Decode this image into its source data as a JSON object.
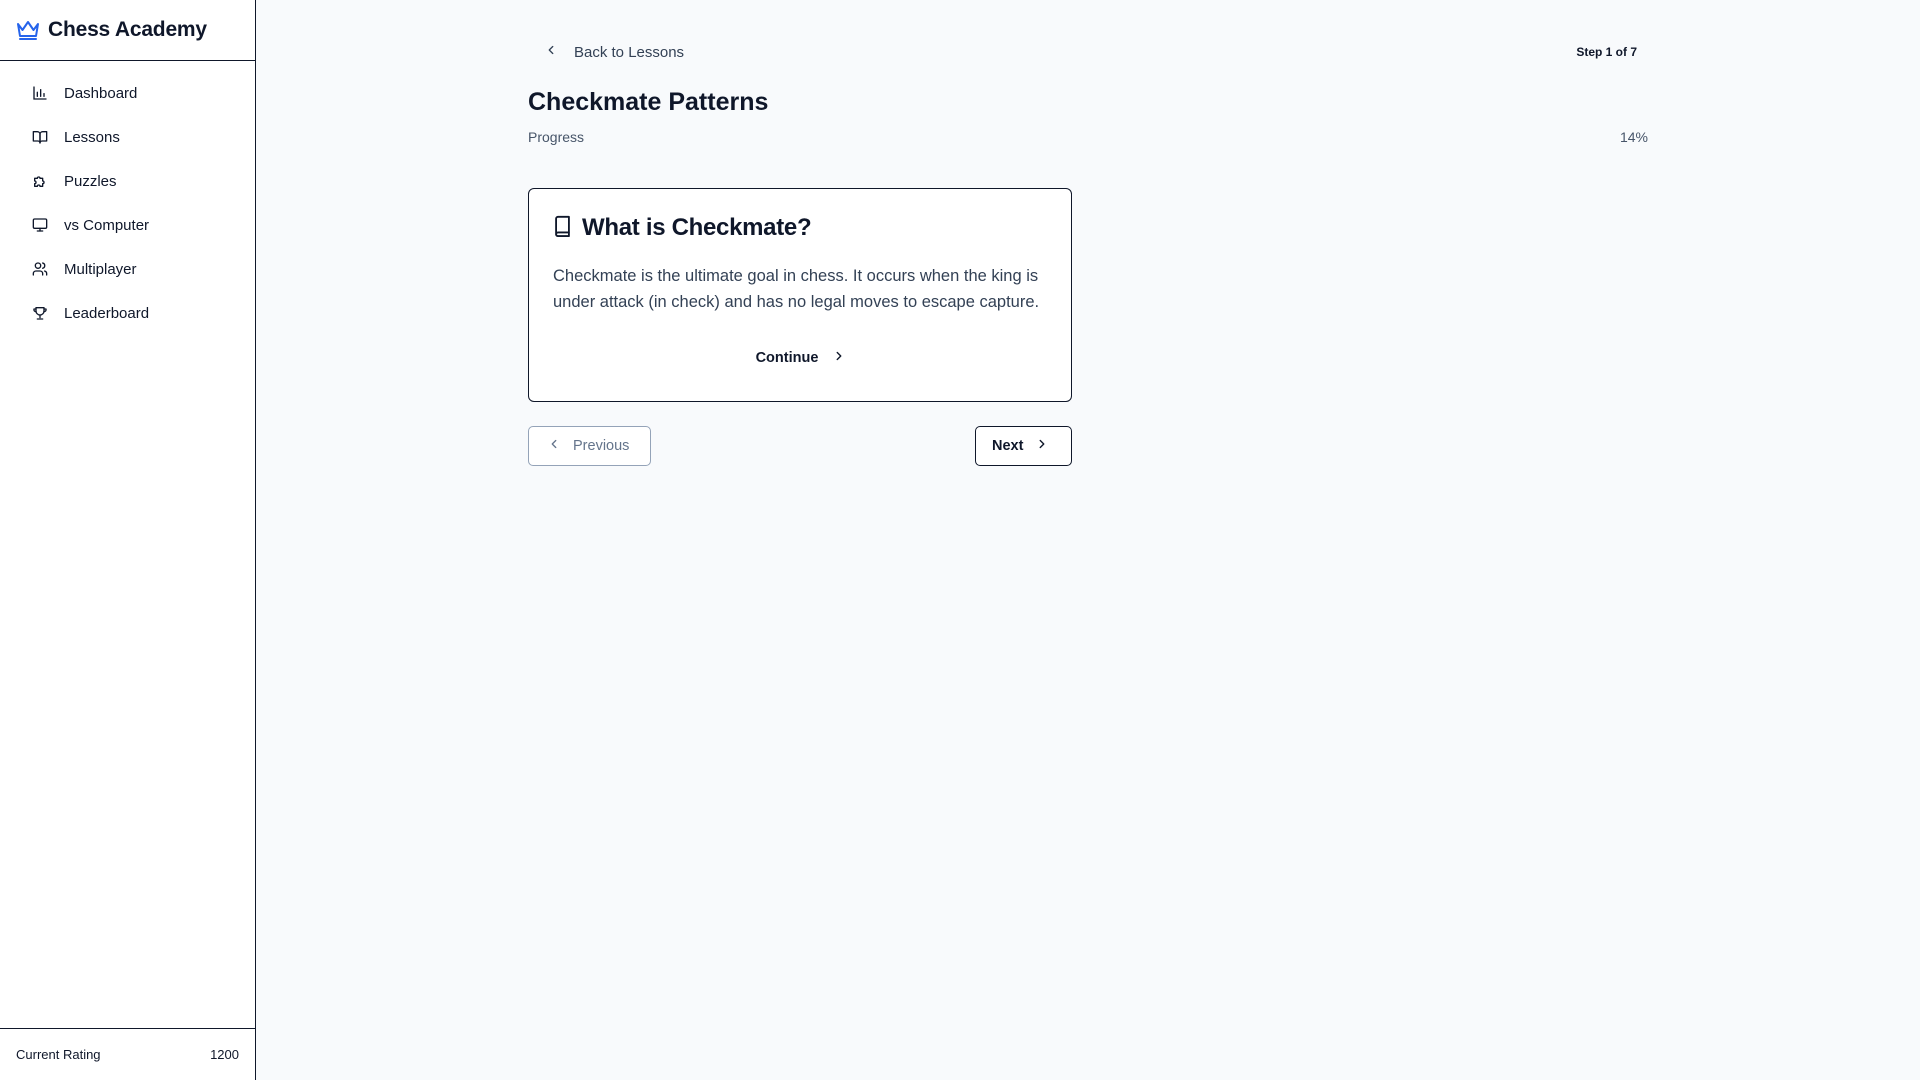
{
  "app": {
    "title": "Chess Academy",
    "brand_icon": "crown-icon",
    "accent_color": "#2563eb"
  },
  "sidebar": {
    "items": [
      {
        "label": "Dashboard",
        "icon": "bar-chart-icon"
      },
      {
        "label": "Lessons",
        "icon": "book-open-icon"
      },
      {
        "label": "Puzzles",
        "icon": "puzzle-icon"
      },
      {
        "label": "vs Computer",
        "icon": "monitor-icon"
      },
      {
        "label": "Multiplayer",
        "icon": "users-icon"
      },
      {
        "label": "Leaderboard",
        "icon": "trophy-icon"
      }
    ],
    "footer": {
      "rating_label": "Current Rating",
      "rating_value": "1200"
    }
  },
  "lesson": {
    "back_label": "Back to Lessons",
    "step_text": "Step 1 of 7",
    "title": "Checkmate Patterns",
    "progress_label": "Progress",
    "progress_percent": "14%",
    "card": {
      "icon": "book-icon",
      "title": "What is Checkmate?",
      "body": "Checkmate is the ultimate goal in chess. It occurs when the king is under attack (in check) and has no legal moves to escape capture.",
      "continue_label": "Continue"
    },
    "previous_label": "Previous",
    "next_label": "Next"
  }
}
